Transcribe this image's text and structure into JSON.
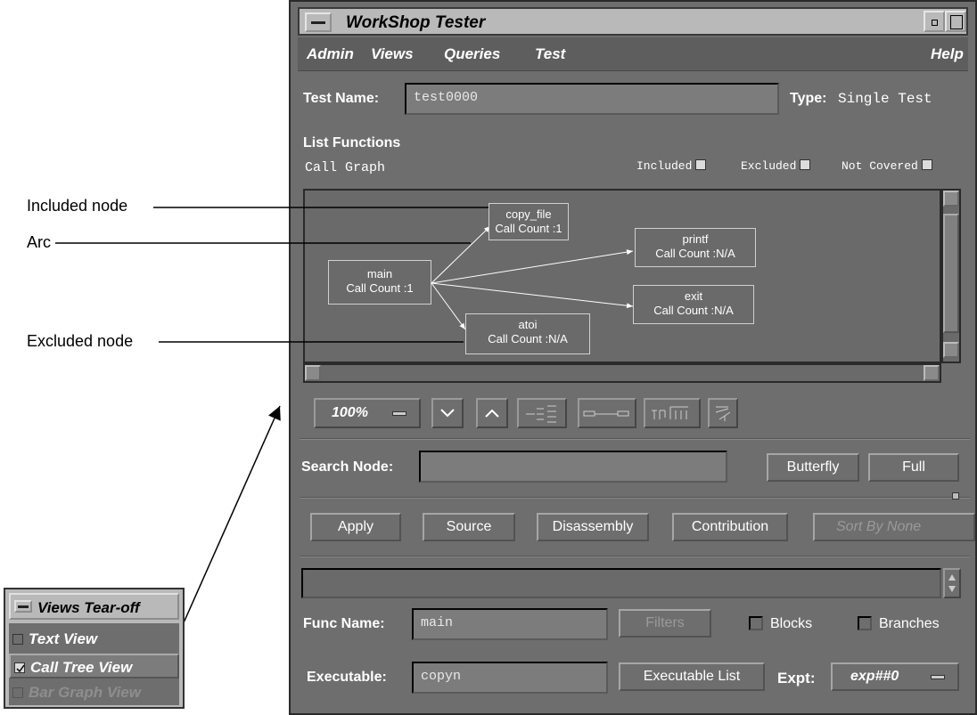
{
  "window": {
    "title": "WorkShop Tester",
    "menu": [
      "Admin",
      "Views",
      "Queries",
      "Test",
      "Help"
    ]
  },
  "test": {
    "name_label": "Test Name:",
    "name_value": "test0000",
    "type_label": "Type:",
    "type_value": "Single Test"
  },
  "list_functions": {
    "label": "List Functions",
    "view_label": "Call Graph",
    "legend": [
      "Included",
      "Excluded",
      "Not Covered"
    ]
  },
  "graph": {
    "nodes": [
      {
        "name": "copy_file",
        "count": "Call Count :1"
      },
      {
        "name": "main",
        "count": "Call Count :1"
      },
      {
        "name": "printf",
        "count": "Call Count :N/A"
      },
      {
        "name": "exit",
        "count": "Call Count :N/A"
      },
      {
        "name": "atoi",
        "count": "Call Count :N/A"
      }
    ]
  },
  "toolbar": {
    "zoom": "100%"
  },
  "search": {
    "label": "Search Node:",
    "value": "",
    "butterfly": "Butterfly",
    "full": "Full"
  },
  "actions": {
    "apply": "Apply",
    "source": "Source",
    "disassembly": "Disassembly",
    "contribution": "Contribution",
    "sort": "Sort By None"
  },
  "func": {
    "label": "Func Name:",
    "value": "main",
    "filters": "Filters",
    "blocks": "Blocks",
    "branches": "Branches"
  },
  "executable": {
    "label": "Executable:",
    "value": "copyn",
    "list_button": "Executable List",
    "expt_label": "Expt:",
    "expt_value": "exp##0"
  },
  "annotations": {
    "included": "Included node",
    "arc": "Arc",
    "excluded": "Excluded node"
  },
  "tearoff": {
    "title": "Views Tear-off",
    "items": [
      "Text View",
      "Call Tree View",
      "Bar Graph View"
    ]
  }
}
